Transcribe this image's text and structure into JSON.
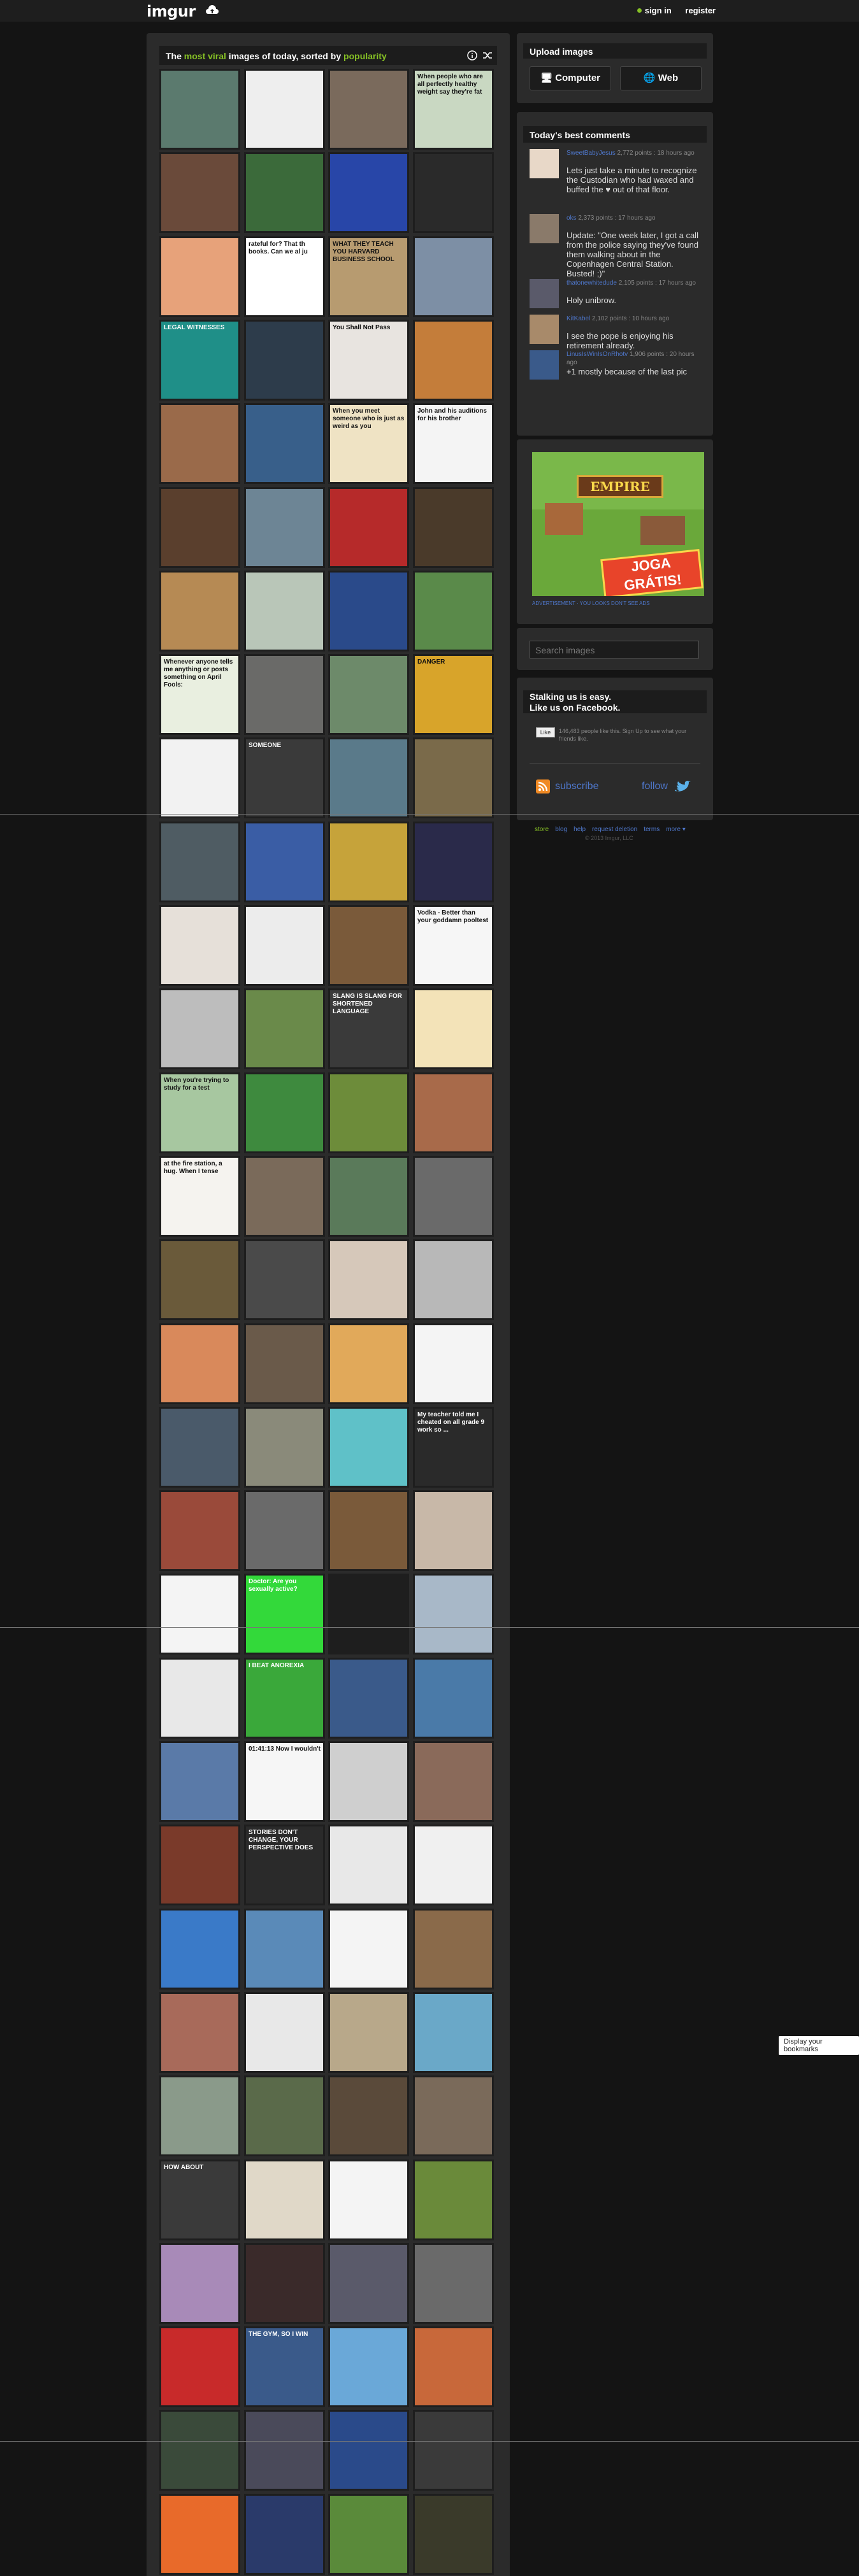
{
  "header": {
    "logo": "imgur",
    "sign_in": "sign in",
    "register": "register"
  },
  "gallery": {
    "title_pre": "The ",
    "title_hl1": "most viral",
    "title_mid": " images of today, sorted by ",
    "title_hl2": "popularity",
    "tiles": [
      {
        "bg": "#5b7a6e"
      },
      {
        "bg": "#eeeeee",
        "text": ""
      },
      {
        "bg": "#7a6a5c"
      },
      {
        "bg": "#c9d8c2",
        "text": "When people who are all perfectly healthy weight say they're fat"
      },
      {
        "bg": "#6a4a3a"
      },
      {
        "bg": "#3b6a3a"
      },
      {
        "bg": "#2846a8"
      },
      {
        "bg": "#2a2a2a"
      },
      {
        "bg": "#e7a27a"
      },
      {
        "bg": "#ffffff",
        "text": "rateful for? That th books. Can we al ju"
      },
      {
        "bg": "#b79b70",
        "text": "WHAT THEY TEACH YOU HARVARD BUSINESS SCHOOL"
      },
      {
        "bg": "#7d8fa5"
      },
      {
        "bg": "#1f8f88",
        "text": "LEGAL WITNESSES"
      },
      {
        "bg": "#2d3c4b"
      },
      {
        "bg": "#e8e4e0",
        "text": "You Shall Not Pass"
      },
      {
        "bg": "#c47d3a"
      },
      {
        "bg": "#9a6a4a"
      },
      {
        "bg": "#385f8a"
      },
      {
        "bg": "#efe3c4",
        "text": "When you meet someone who is just as weird as you"
      },
      {
        "bg": "#f4f4f4",
        "text": "John and his auditions for his brother"
      },
      {
        "bg": "#5a3f2d"
      },
      {
        "bg": "#6d8595"
      },
      {
        "bg": "#b62a2a"
      },
      {
        "bg": "#4a3a2a"
      },
      {
        "bg": "#b68a54"
      },
      {
        "bg": "#b9c6b8"
      },
      {
        "bg": "#2a4a8a"
      },
      {
        "bg": "#5a8a4a"
      },
      {
        "bg": "#e9efe0",
        "text": "Whenever anyone tells me anything or posts something on April Fools:"
      },
      {
        "bg": "#6a6a68"
      },
      {
        "bg": "#6d8a6a"
      },
      {
        "bg": "#d8a42a",
        "text": "DANGER"
      },
      {
        "bg": "#f2f2f2"
      },
      {
        "bg": "#3a3a3a",
        "text": "SOMEONE"
      },
      {
        "bg": "#5a7a8a"
      },
      {
        "bg": "#7a6a4a"
      },
      {
        "bg": "#4f5c63"
      },
      {
        "bg": "#3a5da5"
      },
      {
        "bg": "#c6a33a"
      },
      {
        "bg": "#2a2a4a"
      },
      {
        "bg": "#e6e0d9"
      },
      {
        "bg": "#ececec"
      },
      {
        "bg": "#7a5a3a"
      },
      {
        "bg": "#f6f6f6",
        "text": "Vodka - Better than your goddamn pooltest"
      },
      {
        "bg": "#bdbdbd"
      },
      {
        "bg": "#6a8a4a"
      },
      {
        "bg": "#3a3a3a",
        "text": "SLANG IS SLANG FOR SHORTENED LANGUAGE"
      },
      {
        "bg": "#f3e3b8"
      },
      {
        "bg": "#a7c7a0",
        "text": "When you're trying to study for a test"
      },
      {
        "bg": "#3e8a3e"
      },
      {
        "bg": "#6d8c3a"
      },
      {
        "bg": "#a86a4a"
      },
      {
        "bg": "#f5f3ef",
        "text": "at the fire station, a hug. When I tense"
      },
      {
        "bg": "#7a6a5a"
      },
      {
        "bg": "#5a7a5a"
      },
      {
        "bg": "#6a6a6a"
      },
      {
        "bg": "#6a5a3a"
      },
      {
        "bg": "#4a4a4a"
      },
      {
        "bg": "#d6c8ba"
      },
      {
        "bg": "#b8b8b8"
      },
      {
        "bg": "#d9895b"
      },
      {
        "bg": "#6a5a4a"
      },
      {
        "bg": "#e1a95a"
      },
      {
        "bg": "#f4f4f4"
      },
      {
        "bg": "#4a5a6a"
      },
      {
        "bg": "#8a8a7a"
      },
      {
        "bg": "#5fc1c8"
      },
      {
        "bg": "#2a2a2a",
        "text": "My teacher told me I cheated on all grade 9 work so ..."
      },
      {
        "bg": "#9a4a3a"
      },
      {
        "bg": "#6a6a6a"
      },
      {
        "bg": "#7a5a3a"
      },
      {
        "bg": "#c8b8a8"
      },
      {
        "bg": "#f4f4f4"
      },
      {
        "bg": "#33d93a",
        "text": "Doctor: Are you sexually active?"
      },
      {
        "bg": "#1e1e1e"
      },
      {
        "bg": "#a8b8c8"
      },
      {
        "bg": "#e8e8e8"
      },
      {
        "bg": "#3aa83a",
        "text": "I BEAT ANOREXIA"
      },
      {
        "bg": "#3a5a8a"
      },
      {
        "bg": "#4a7aa8"
      },
      {
        "bg": "#5a7aa8"
      },
      {
        "bg": "#f6f6f6",
        "text": "01:41:13 Now I wouldn't"
      },
      {
        "bg": "#cfcfcf"
      },
      {
        "bg": "#8a6a5a"
      },
      {
        "bg": "#7a3a2a"
      },
      {
        "bg": "#2a2a2a",
        "text": "STORIES DON'T CHANGE, YOUR PERSPECTIVE DOES"
      },
      {
        "bg": "#e8e8e8"
      },
      {
        "bg": "#f0f0f0"
      },
      {
        "bg": "#3a7ac8"
      },
      {
        "bg": "#5a8ab8"
      },
      {
        "bg": "#f4f4f4"
      },
      {
        "bg": "#8a6a4a"
      },
      {
        "bg": "#a86a5a"
      },
      {
        "bg": "#e8e8e8"
      },
      {
        "bg": "#b8a88a"
      },
      {
        "bg": "#6aa8c8"
      },
      {
        "bg": "#8a9a8a"
      },
      {
        "bg": "#5a6a4a"
      },
      {
        "bg": "#5a4a3a"
      },
      {
        "bg": "#7a6a5a"
      },
      {
        "bg": "#3a3a3a",
        "text": "HOW ABOUT"
      },
      {
        "bg": "#e0d8c8"
      },
      {
        "bg": "#f4f4f4"
      },
      {
        "bg": "#6a8a3a"
      },
      {
        "bg": "#a88ab8"
      },
      {
        "bg": "#3a2a2a"
      },
      {
        "bg": "#5a5a6a"
      },
      {
        "bg": "#6a6a6a"
      },
      {
        "bg": "#c82a2a"
      },
      {
        "bg": "#3a5a8a",
        "text": "THE GYM, SO I WIN"
      },
      {
        "bg": "#6aa8d8"
      },
      {
        "bg": "#c8683a"
      },
      {
        "bg": "#3a4a3a"
      },
      {
        "bg": "#4a4a5a"
      },
      {
        "bg": "#2a4a8a"
      },
      {
        "bg": "#3a3a3a"
      },
      {
        "bg": "#e86a2a"
      },
      {
        "bg": "#2a3a6a"
      },
      {
        "bg": "#5a8a3a"
      },
      {
        "bg": "#3a3a2a"
      }
    ]
  },
  "upload": {
    "title": "Upload images",
    "computer": "Computer",
    "web": "Web"
  },
  "comments": {
    "title": "Today's best comments",
    "items": [
      {
        "author": "SweetBabyJesus",
        "meta": "2,772 points : 18 hours ago",
        "text": "Lets just take a minute to recognize the Custodian who had waxed and buffed the ♥ out of that floor.",
        "thumb": "#e8d8c8"
      },
      {
        "author": "oks",
        "meta": "2,373 points : 17 hours ago",
        "text": "Update: \"One week later, I got a call from the police saying they've found them walking about in the Copenhagen Central Station. Busted! ;)\"",
        "thumb": "#8a7a6a"
      },
      {
        "author": "thatonewhitedude",
        "meta": "2,105 points : 17 hours ago",
        "text": "Holy unibrow.",
        "thumb": "#5a5a6a"
      },
      {
        "author": "KitKabel",
        "meta": "2,102 points : 10 hours ago",
        "text": "I see the pope is enjoying his retirement already.",
        "thumb": "#a88a6a"
      },
      {
        "author": "LinusIsWinIsOnRhotv",
        "meta": "1,906 points : 20 hours ago",
        "text": "+1 mostly because of the last pic",
        "thumb": "#3a5a8a"
      }
    ]
  },
  "ad": {
    "title": "EMPIRE",
    "cta": "JOGA GRÁTIS!",
    "footer": "ADVERTISEMENT · YOU LOOKS DON'T SEE ADS"
  },
  "search": {
    "placeholder": "Search images"
  },
  "social": {
    "title": "Stalking us is easy.",
    "subtitle": "Like us on Facebook.",
    "like_label": "Like",
    "like_text": "146,483 people like this. Sign Up to see what your friends like.",
    "subscribe": "subscribe",
    "follow": "follow"
  },
  "footer": {
    "links": [
      "store",
      "blog",
      "help",
      "request deletion",
      "terms",
      "more ▾"
    ],
    "copyright": "© 2013 Imgur, LLC"
  },
  "bookmark_tip": "Display your bookmarks"
}
